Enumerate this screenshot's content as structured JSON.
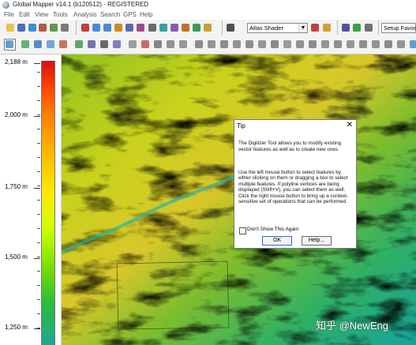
{
  "window": {
    "title": "Global Mapper v14.1 (b120512) - REGISTERED"
  },
  "menu": [
    "File",
    "Edit",
    "View",
    "Tools",
    "Analysis",
    "Search",
    "GPS",
    "Help"
  ],
  "toolbar": {
    "shader_value": "Atlas Shader",
    "favorites_value": "Setup Favorite"
  },
  "elevation_legend": {
    "labels": [
      "2,188 m",
      "2,000 m",
      "1,750 m",
      "1,500 m",
      "1,250 m"
    ],
    "ramp_colors": [
      "#d21212",
      "#ff7a00",
      "#ffe600",
      "#7ee000",
      "#1fa88e"
    ]
  },
  "tip_dialog": {
    "title": "Tip",
    "close_glyph": "✕",
    "paragraphs": [
      "The Digitizer Tool allows you to modify existing vector features as well as to create new ones.",
      "Use the left mouse button to select features by either clicking on them or dragging a box to select multiple features. If polyline vertices are being displayed (Shift+V), you can select them as well.\nClick the right mouse button to bring up a context-sensitive set of operations that can be performed."
    ],
    "checkbox_label": "Don't Show This Again",
    "ok_label": "OK",
    "help_label": "Help..."
  },
  "watermark": "知乎 @NewEng"
}
